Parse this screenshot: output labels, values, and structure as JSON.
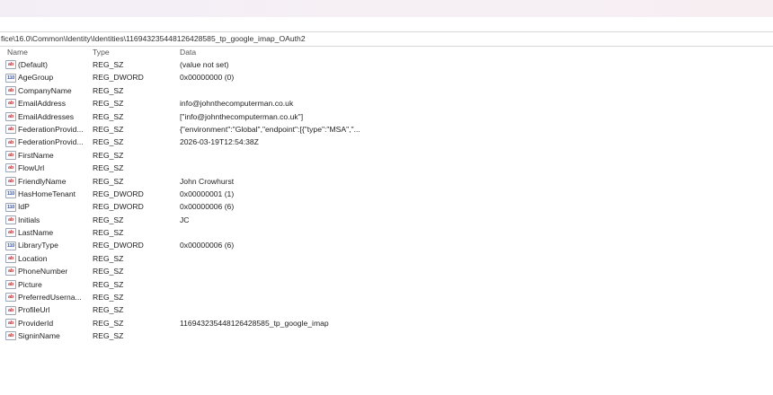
{
  "address_path": "fice\\16.0\\Common\\Identity\\Identities\\116943235448126428585_tp_google_imap_OAuth2",
  "columns": {
    "name": "Name",
    "type": "Type",
    "data": "Data"
  },
  "rows": [
    {
      "name": "(Default)",
      "type": "REG_SZ",
      "data": "(value not set)",
      "icon": "string-value-icon",
      "icon_text": "ab"
    },
    {
      "name": "AgeGroup",
      "type": "REG_DWORD",
      "data": "0x00000000 (0)",
      "icon": "dword-value-icon",
      "icon_text": "110"
    },
    {
      "name": "CompanyName",
      "type": "REG_SZ",
      "data": "",
      "icon": "string-value-icon",
      "icon_text": "ab"
    },
    {
      "name": "EmailAddress",
      "type": "REG_SZ",
      "data": "info@johnthecomputerman.co.uk",
      "icon": "string-value-icon",
      "icon_text": "ab"
    },
    {
      "name": "EmailAddresses",
      "type": "REG_SZ",
      "data": "[\"info@johnthecomputerman.co.uk\"]",
      "icon": "string-value-icon",
      "icon_text": "ab"
    },
    {
      "name": "FederationProvid...",
      "type": "REG_SZ",
      "data": "{\"environment\":\"Global\",\"endpoint\":[{\"type\":\"MSA\",\"...",
      "icon": "string-value-icon",
      "icon_text": "ab"
    },
    {
      "name": "FederationProvid...",
      "type": "REG_SZ",
      "data": "2026-03-19T12:54:38Z",
      "icon": "string-value-icon",
      "icon_text": "ab"
    },
    {
      "name": "FirstName",
      "type": "REG_SZ",
      "data": "",
      "icon": "string-value-icon",
      "icon_text": "ab"
    },
    {
      "name": "FlowUrl",
      "type": "REG_SZ",
      "data": "",
      "icon": "string-value-icon",
      "icon_text": "ab"
    },
    {
      "name": "FriendlyName",
      "type": "REG_SZ",
      "data": "John Crowhurst",
      "icon": "string-value-icon",
      "icon_text": "ab"
    },
    {
      "name": "HasHomeTenant",
      "type": "REG_DWORD",
      "data": "0x00000001 (1)",
      "icon": "dword-value-icon",
      "icon_text": "110"
    },
    {
      "name": "IdP",
      "type": "REG_DWORD",
      "data": "0x00000006 (6)",
      "icon": "dword-value-icon",
      "icon_text": "110"
    },
    {
      "name": "Initials",
      "type": "REG_SZ",
      "data": "JC",
      "icon": "string-value-icon",
      "icon_text": "ab"
    },
    {
      "name": "LastName",
      "type": "REG_SZ",
      "data": "",
      "icon": "string-value-icon",
      "icon_text": "ab"
    },
    {
      "name": "LibraryType",
      "type": "REG_DWORD",
      "data": "0x00000006 (6)",
      "icon": "dword-value-icon",
      "icon_text": "110"
    },
    {
      "name": "Location",
      "type": "REG_SZ",
      "data": "",
      "icon": "string-value-icon",
      "icon_text": "ab"
    },
    {
      "name": "PhoneNumber",
      "type": "REG_SZ",
      "data": "",
      "icon": "string-value-icon",
      "icon_text": "ab"
    },
    {
      "name": "Picture",
      "type": "REG_SZ",
      "data": "",
      "icon": "string-value-icon",
      "icon_text": "ab"
    },
    {
      "name": "PreferredUserna...",
      "type": "REG_SZ",
      "data": "",
      "icon": "string-value-icon",
      "icon_text": "ab"
    },
    {
      "name": "ProfileUrl",
      "type": "REG_SZ",
      "data": "",
      "icon": "string-value-icon",
      "icon_text": "ab"
    },
    {
      "name": "ProviderId",
      "type": "REG_SZ",
      "data": "116943235448126428585_tp_google_imap",
      "icon": "string-value-icon",
      "icon_text": "ab"
    },
    {
      "name": "SigninName",
      "type": "REG_SZ",
      "data": "",
      "icon": "string-value-icon",
      "icon_text": "ab"
    }
  ]
}
